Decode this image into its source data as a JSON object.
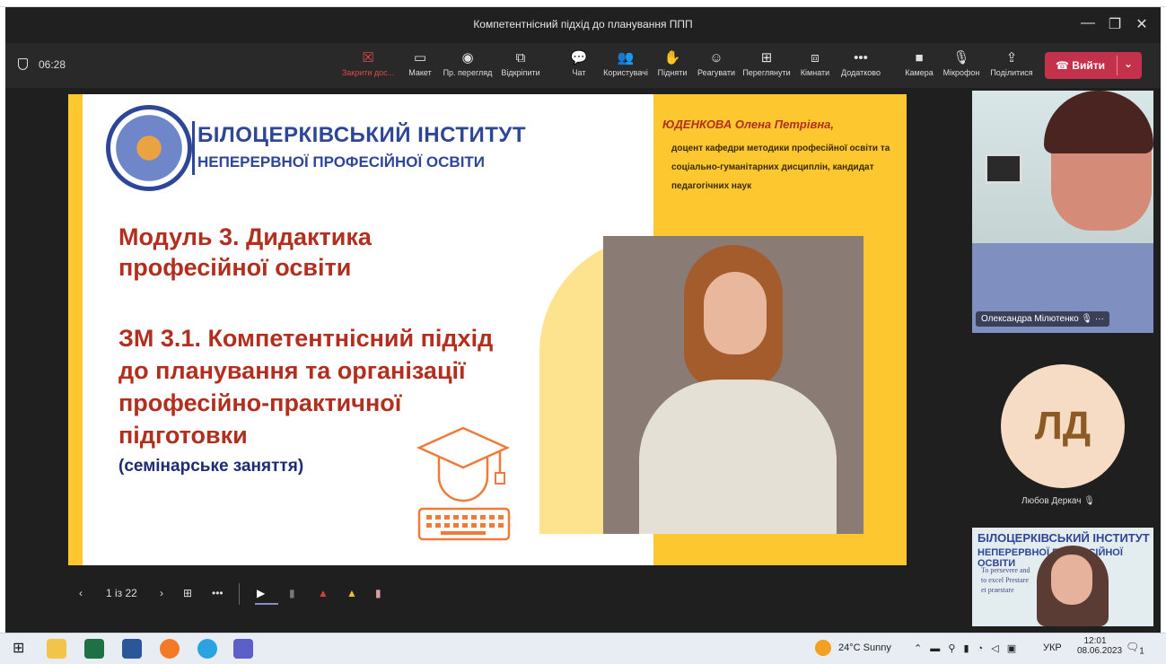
{
  "window": {
    "title": "Компетентнісний підхід до планування ППП",
    "min": "—",
    "max": "❐",
    "close": "✕"
  },
  "meeting": {
    "timer": "06:28",
    "toolbar": [
      {
        "key": "close_share",
        "icon": "☒",
        "label": "Закрити дос..."
      },
      {
        "key": "layout",
        "icon": "▭",
        "label": "Макет"
      },
      {
        "key": "view",
        "icon": "◉",
        "label": "Пр. перегляд"
      },
      {
        "key": "popout",
        "icon": "⧉",
        "label": "Відкріпити"
      },
      {
        "key": "chat",
        "icon": "💬",
        "label": "Чат"
      },
      {
        "key": "people",
        "icon": "👥",
        "label": "Користувачі"
      },
      {
        "key": "raise",
        "icon": "✋",
        "label": "Підняти"
      },
      {
        "key": "react",
        "icon": "☺",
        "label": "Реагувати"
      },
      {
        "key": "view_switch",
        "icon": "⊞",
        "label": "Переглянути"
      },
      {
        "key": "rooms",
        "icon": "⧈",
        "label": "Кімнати"
      },
      {
        "key": "more",
        "icon": "•••",
        "label": "Додатково"
      },
      {
        "key": "camera",
        "icon": "■",
        "label": "Камера"
      },
      {
        "key": "mic",
        "icon": "🎙",
        "label": "Мікрофон"
      },
      {
        "key": "share",
        "icon": "⇪",
        "label": "Поділитися"
      }
    ],
    "leave_label": "Вийти"
  },
  "slide": {
    "institute_line1": "БІЛОЦЕРКІВСЬКИЙ ІНСТИТУТ",
    "institute_line2": "НЕПЕРЕРВНОЇ ПРОФЕСІЙНОЇ ОСВІТИ",
    "module_title": "Модуль 3. Дидактика професійної освіти",
    "submodule_title": "ЗМ 3.1. Компетентнісний підхід до планування та організації професійно-практичної підготовки",
    "session_type": "(семінарське заняття)",
    "author_name": "ЮДЕНКОВА Олена Петрівна",
    "author_name_suffix": ",",
    "author_position": "доцент кафедри методики професійної освіти та соціально-гуманітарних дисциплін, кандидат педагогічних наук",
    "colors": {
      "accent_yellow": "#fdc82f",
      "title_red": "#b22f1f",
      "institute_blue": "#2e4696"
    }
  },
  "slide_controls": {
    "prev": "‹",
    "page": "1 із 22",
    "next": "›",
    "grid": "⊞",
    "more": "•••"
  },
  "participants": [
    {
      "name": "Олександра Мілютенко",
      "muted": true
    },
    {
      "initials": "ЛД",
      "name": "Любов Деркач",
      "muted": true
    }
  ],
  "participant3": {
    "banner1": "БІЛОЦЕРКІВСЬКИЙ ІНСТИТУТ",
    "banner2": "НЕПЕРЕРВНОЇ ПРОФЕСІЙНОЇ ОСВІТИ",
    "motto": "To persevere and to excel Prestare et praestare"
  },
  "taskbar": {
    "weather": "24°C Sunny",
    "lang": "УКР",
    "time": "12:01",
    "date": "08.06.2023",
    "notif_count": "1"
  }
}
